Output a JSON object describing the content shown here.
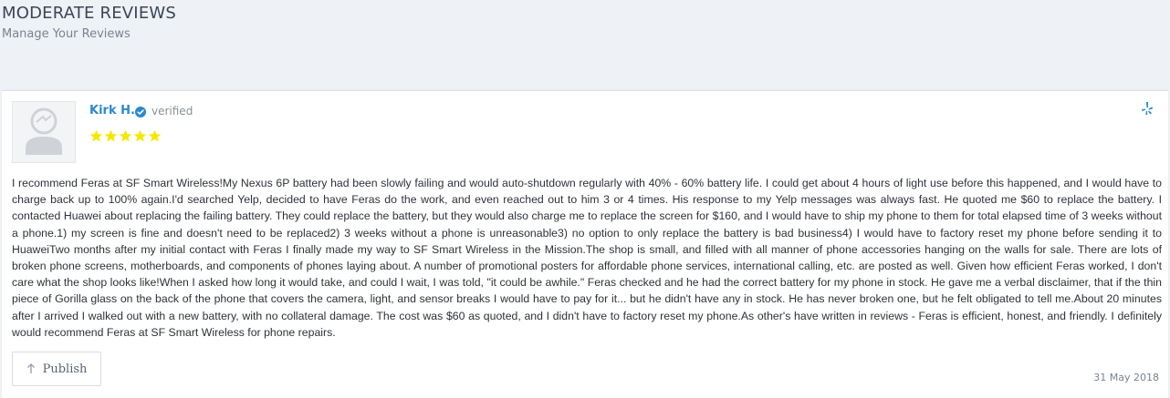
{
  "header": {
    "title": "MODERATE REVIEWS",
    "subtitle": "Manage Your Reviews"
  },
  "review": {
    "reviewer_name": "Kirk H.",
    "verified_label": "verified",
    "rating": 5,
    "rating_max": 5,
    "source_icon": "yelp-icon",
    "text": "I recommend Feras at SF Smart Wireless!My Nexus 6P battery had been slowly failing and would auto-shutdown regularly with 40% - 60% battery life. I could get about 4 hours of light use before this happened, and I would have to charge back up to 100% again.I'd searched Yelp, decided to have Feras do the work, and even reached out to him 3 or 4 times. His response to my Yelp messages was always fast. He quoted me $60 to replace the battery. I contacted Huawei about replacing the failing battery. They could replace the battery, but they would also charge me to replace the screen for $160, and I would have to ship my phone to them for total elapsed time of 3 weeks without a phone.1) my screen is fine and doesn't need to be replaced2) 3 weeks without a phone is unreasonable3) no option to only replace the battery is bad business4) I would have to factory reset my phone before sending it to HuaweiTwo months after my initial contact with Feras I finally made my way to SF Smart Wireless in the Mission.The shop is small, and filled with all manner of phone accessories hanging on the walls for sale. There are lots of broken phone screens, motherboards, and components of phones laying about. A number of promotional posters for affordable phone services, international calling, etc. are posted as well. Given how efficient Feras worked, I don't care what the shop looks like!When I asked how long it would take, and could I wait, I was told, \"it could be awhile.\" Feras checked and he had the correct battery for my phone in stock. He gave me a verbal disclaimer, that if the thin piece of Gorilla glass on the back of the phone that covers the camera, light, and sensor breaks I would have to pay for it... but he didn't have any in stock. He has never broken one, but he felt obligated to tell me.About 20 minutes after I arrived I walked out with a new battery, with no collateral damage. The cost was $60 as quoted, and I didn't have to factory reset my phone.As other's have written in reviews - Feras is efficient, honest, and friendly. I definitely would recommend Feras at SF Smart Wireless for phone repairs.",
    "publish_label": "Publish",
    "date": "31 May 2018"
  },
  "colors": {
    "background": "#eef1f5",
    "name_link": "#2a8ad0",
    "star": "#f5e800",
    "verified_badge": "#2a8ad0",
    "yelp": "#2a8ad0"
  }
}
